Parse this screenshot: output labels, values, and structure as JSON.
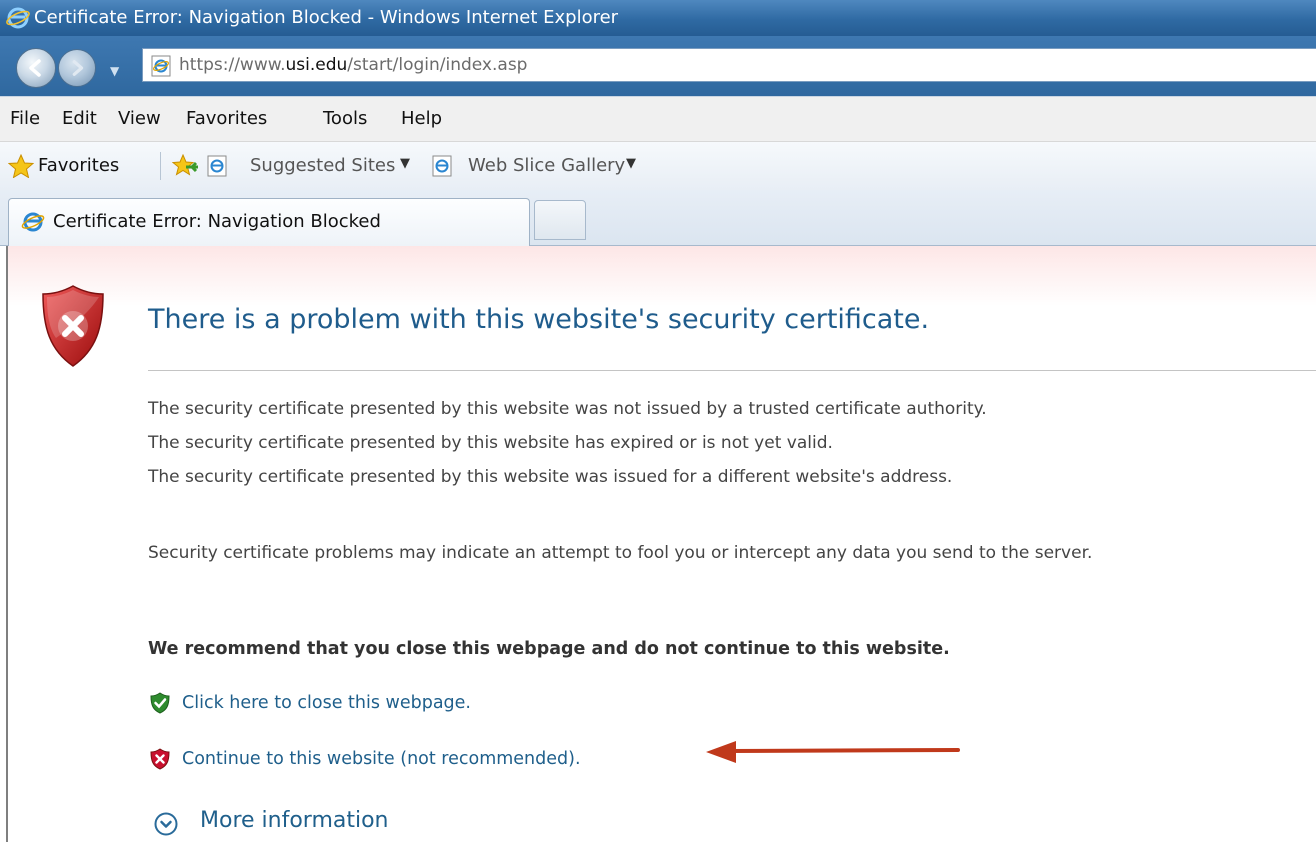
{
  "window": {
    "title": "Certificate Error: Navigation Blocked - Windows Internet Explorer"
  },
  "address": {
    "url_prefix": "https://www.",
    "url_domain": "usi.edu",
    "url_suffix": "/start/login/index.asp"
  },
  "menu": {
    "items": [
      "File",
      "Edit",
      "View",
      "Favorites",
      "Tools",
      "Help"
    ]
  },
  "favorites_bar": {
    "favorites_label": "Favorites",
    "links": [
      "Suggested Sites",
      "Web Slice Gallery"
    ]
  },
  "tabs": {
    "active_label": "Certificate Error: Navigation Blocked"
  },
  "page": {
    "title": "There is a problem with this website's security certificate.",
    "reasons": [
      "The security certificate presented by this website was not issued by a trusted certificate authority.",
      "The security certificate presented by this website has expired or is not yet valid.",
      "The security certificate presented by this website was issued for a different website's address."
    ],
    "warning": "Security certificate problems may indicate an attempt to fool you or intercept any data you send to the server.",
    "recommendation": "We recommend that you close this webpage and do not continue to this website.",
    "close_link": "Click here to close this webpage.",
    "continue_link": "Continue to this website (not recommended).",
    "more_info": "More information"
  },
  "colors": {
    "title_bar": "#2f6aa3",
    "link": "#1f5f8b",
    "heading": "#1f5c8c",
    "annotation_arrow": "#c0391b",
    "error_shield": "#c8102e",
    "safe_shield": "#2e8b2e"
  },
  "icons": {
    "browser": "internet-explorer-icon",
    "error": "shield-error-icon",
    "close_action": "green-shield-check-icon",
    "continue_action": "red-shield-x-icon",
    "more_info": "expand-chevron-icon"
  }
}
